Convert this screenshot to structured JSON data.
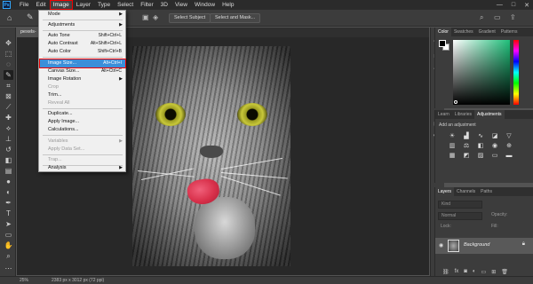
{
  "menubar": {
    "logo": "Ps",
    "items": [
      "File",
      "Edit",
      "Image",
      "Layer",
      "Type",
      "Select",
      "Filter",
      "3D",
      "View",
      "Window",
      "Help"
    ],
    "window_controls": [
      "—",
      "□",
      "✕"
    ]
  },
  "options_bar": {
    "select_subject": "Select Subject",
    "select_and_mask": "Select and Mask..."
  },
  "document": {
    "tab_name": "pexels-",
    "zoom": "25%",
    "dimensions": "2383 px x 3012 px (72 ppi)"
  },
  "image_menu": {
    "items": [
      {
        "label": "Mode",
        "shortcut": "",
        "submenu": true,
        "disabled": false
      },
      {
        "label": "Adjustments",
        "shortcut": "",
        "submenu": true,
        "disabled": false
      },
      {
        "label": "Auto Tone",
        "shortcut": "Shift+Ctrl+L",
        "submenu": false,
        "disabled": false
      },
      {
        "label": "Auto Contrast",
        "shortcut": "Alt+Shift+Ctrl+L",
        "submenu": false,
        "disabled": false
      },
      {
        "label": "Auto Color",
        "shortcut": "Shift+Ctrl+B",
        "submenu": false,
        "disabled": false
      },
      {
        "label": "Image Size...",
        "shortcut": "Alt+Ctrl+I",
        "submenu": false,
        "disabled": false,
        "highlighted": true
      },
      {
        "label": "Canvas Size...",
        "shortcut": "Alt+Ctrl+C",
        "submenu": false,
        "disabled": false
      },
      {
        "label": "Image Rotation",
        "shortcut": "",
        "submenu": true,
        "disabled": false
      },
      {
        "label": "Crop",
        "shortcut": "",
        "submenu": false,
        "disabled": true
      },
      {
        "label": "Trim...",
        "shortcut": "",
        "submenu": false,
        "disabled": false
      },
      {
        "label": "Reveal All",
        "shortcut": "",
        "submenu": false,
        "disabled": true
      },
      {
        "label": "Duplicate...",
        "shortcut": "",
        "submenu": false,
        "disabled": false
      },
      {
        "label": "Apply Image...",
        "shortcut": "",
        "submenu": false,
        "disabled": false
      },
      {
        "label": "Calculations...",
        "shortcut": "",
        "submenu": false,
        "disabled": false
      },
      {
        "label": "Variables",
        "shortcut": "",
        "submenu": true,
        "disabled": true
      },
      {
        "label": "Apply Data Set...",
        "shortcut": "",
        "submenu": false,
        "disabled": true
      },
      {
        "label": "Trap...",
        "shortcut": "",
        "submenu": false,
        "disabled": true
      },
      {
        "label": "Analysis",
        "shortcut": "",
        "submenu": true,
        "disabled": false
      }
    ]
  },
  "color_panel": {
    "tabs": [
      "Color",
      "Swatches",
      "Gradient",
      "Patterns"
    ],
    "foreground": "#000000",
    "background": "#ffffff"
  },
  "adjustments_panel": {
    "tabs": [
      "Learn",
      "Libraries",
      "Adjustments"
    ],
    "title": "Add an adjustment"
  },
  "layers_panel": {
    "tabs": [
      "Layers",
      "Channels",
      "Paths"
    ],
    "kind_placeholder": "Kind",
    "blend_mode": "Normal",
    "opacity_label": "Opacity:",
    "lock_label": "Lock:",
    "fill_label": "Fill:",
    "layer_name": "Background"
  }
}
